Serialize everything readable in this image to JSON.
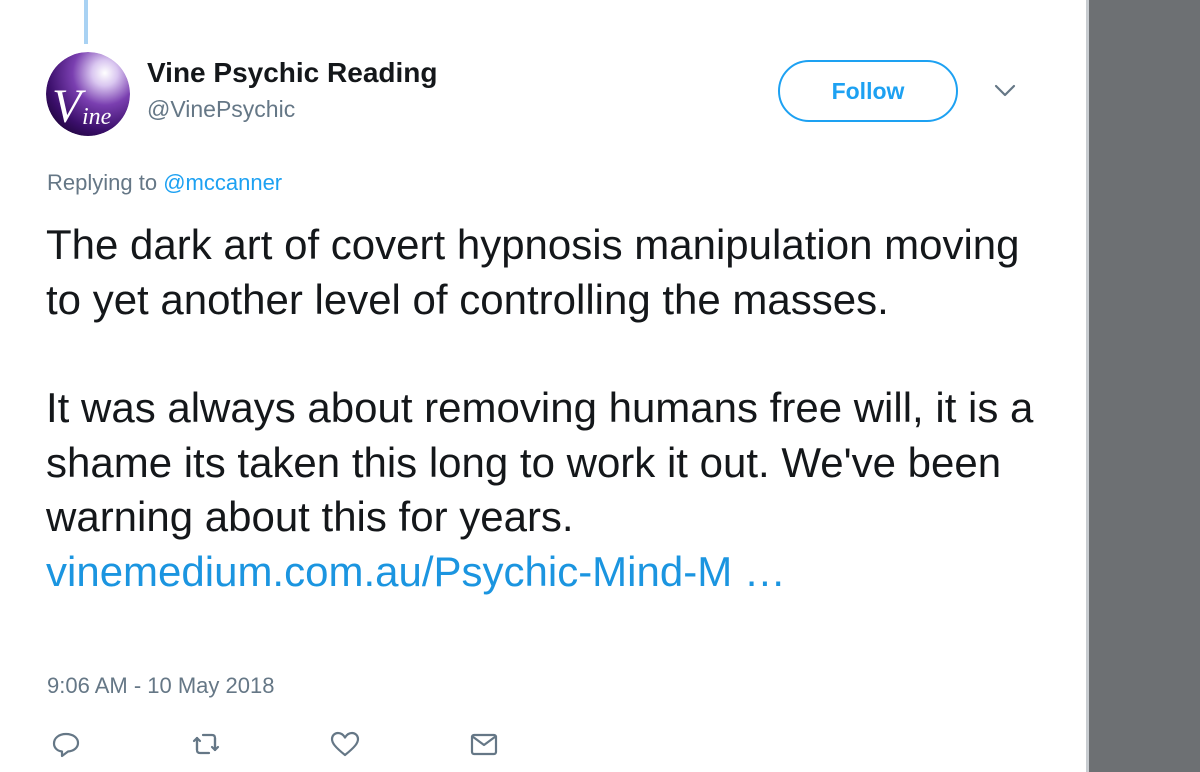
{
  "tweet": {
    "author": {
      "display_name": "Vine Psychic Reading",
      "handle": "@VinePsychic",
      "avatar_text": "Vine"
    },
    "follow_label": "Follow",
    "replying_prefix": "Replying to",
    "replying_to": "@mccanner",
    "paragraphs": [
      "The dark art of covert hypnosis manipulation moving to yet another level of controlling the masses.",
      "It was always about removing humans free will, it is a shame its taken this long to work it out. We've been warning about this for years."
    ],
    "link_text": "vinemedium.com.au/Psychic-Mind-M …",
    "timestamp": "9:06 AM - 10 May 2018"
  },
  "icons": {
    "reply": "reply-icon",
    "retweet": "retweet-icon",
    "like": "heart-icon",
    "dm": "envelope-icon",
    "menu": "chevron-down-icon"
  },
  "colors": {
    "accent": "#1da1f2",
    "text_primary": "#14171a",
    "text_secondary": "#657786",
    "gutter": "#6d7073"
  }
}
